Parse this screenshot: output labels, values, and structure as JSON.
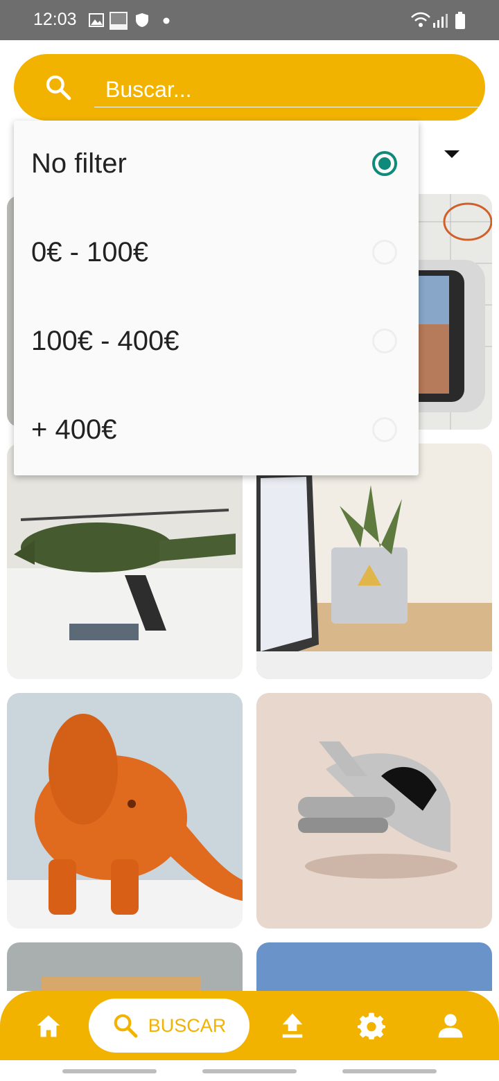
{
  "status_bar": {
    "time": "12:03",
    "icons": [
      "image-icon",
      "orange-icon",
      "shield-icon",
      "dot-icon",
      "wifi-icon",
      "signal-icon",
      "battery-icon"
    ],
    "orange_label": "orange"
  },
  "search": {
    "placeholder": "Buscar...",
    "value": ""
  },
  "filter_menu": {
    "options": [
      {
        "label": "No filter",
        "selected": true
      },
      {
        "label": "0€ - 100€",
        "selected": false
      },
      {
        "label": "100€ - 400€",
        "selected": false
      },
      {
        "label": "+ 400€",
        "selected": false
      }
    ]
  },
  "products": [
    {
      "name": "product-card-1",
      "subject": "gray item"
    },
    {
      "name": "product-card-2",
      "subject": "nintendo switch"
    },
    {
      "name": "product-card-3",
      "subject": "helicopter model"
    },
    {
      "name": "product-card-4",
      "subject": "plant pot"
    },
    {
      "name": "product-card-5",
      "subject": "orange elephant"
    },
    {
      "name": "product-card-6",
      "subject": "spaceship model"
    },
    {
      "name": "product-card-7",
      "subject": "partial"
    },
    {
      "name": "product-card-8",
      "subject": "partial"
    }
  ],
  "bottom_nav": {
    "items": [
      {
        "icon": "home-icon",
        "label": ""
      },
      {
        "icon": "search-icon",
        "label": "BUSCAR",
        "active": true
      },
      {
        "icon": "upload-icon",
        "label": ""
      },
      {
        "icon": "gear-icon",
        "label": ""
      },
      {
        "icon": "user-icon",
        "label": ""
      }
    ]
  },
  "colors": {
    "accent": "#F2B200",
    "radio_selected": "#0f8a7a"
  }
}
